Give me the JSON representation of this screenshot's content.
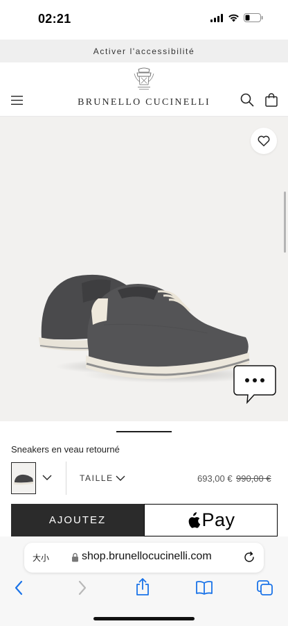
{
  "status_bar": {
    "time": "02:21"
  },
  "accessibility_bar": {
    "label": "Activer l'accessibilité"
  },
  "header": {
    "brand": "BRUNELLO CUCINELLI"
  },
  "product": {
    "title": "Sneakers en veau retourné",
    "size_label": "TAILLE",
    "price_current": "693,00 €",
    "price_old": "990,00 €"
  },
  "actions": {
    "add_label": "AJOUTEZ",
    "applepay_label": "Pay"
  },
  "safari": {
    "aa_label": "大小",
    "url": "shop.brunellocucinelli.com"
  },
  "icons": {
    "menu": "menu-icon",
    "search": "search-icon",
    "bag": "shopping-bag-icon",
    "heart": "heart-icon",
    "chat": "chat-bubble-icon",
    "back": "chevron-left-icon",
    "forward": "chevron-right-icon",
    "share": "share-icon",
    "bookmarks": "book-icon",
    "tabs": "tabs-icon"
  },
  "colors": {
    "accent_dark": "#2b2b2b",
    "image_bg": "#f2f1ef",
    "ios_blue": "#1a73e8"
  }
}
